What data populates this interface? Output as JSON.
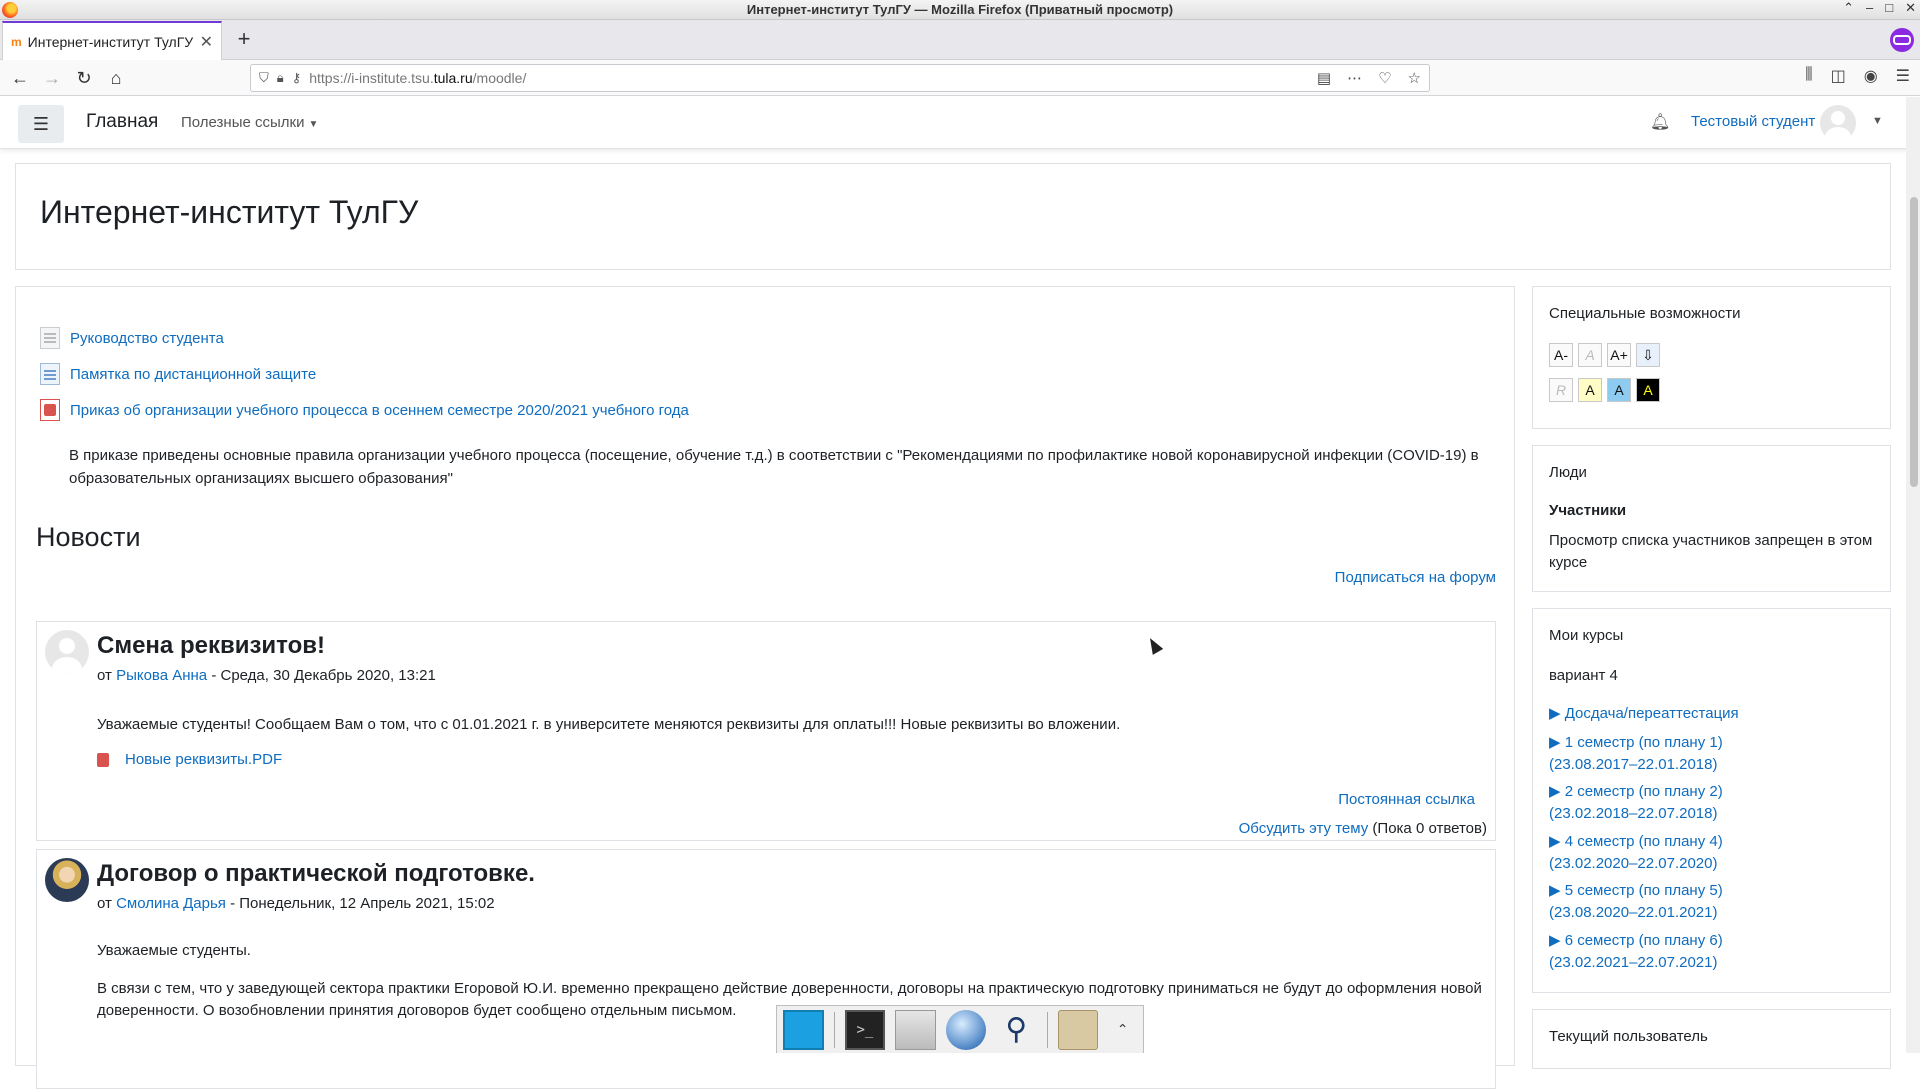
{
  "window": {
    "title": "Интернет-институт ТулГУ — Mozilla Firefox (Приватный просмотр)",
    "buttons": [
      "⌃",
      "–",
      "□",
      "✕"
    ]
  },
  "tabbar": {
    "tab_title": "Интернет-институт ТулГУ",
    "new_tab": "+"
  },
  "navbar": {
    "url_scheme": "https://i-institute.tsu.",
    "url_host": "tula.ru",
    "url_path": "/moodle/"
  },
  "moodle_header": {
    "brand": "Главная",
    "useful_links": "Полезные ссылки",
    "user_name": "Тестовый студент"
  },
  "page_header": {
    "title": "Интернет-институт ТулГУ"
  },
  "activities": [
    {
      "label": "Руководство студента",
      "icon": "page-icon"
    },
    {
      "label": "Памятка по дистанционной защите",
      "icon": "document-icon"
    },
    {
      "label": "Приказ об организации учебного процесса в осеннем семестре 2020/2021 учебного года",
      "icon": "pdf-icon"
    }
  ],
  "activity_description": "В приказе приведены основные правила организации учебного процесса (посещение, обучение т.д.) в соответствии с \"Рекомендациями по профилактике новой коронавирусной инфекции (COVID-19) в образовательных организациях высшего образования\"",
  "news": {
    "title": "Новости",
    "subscribe": "Подписаться на форум",
    "posts": [
      {
        "subject": "Смена реквизитов!",
        "by": "от",
        "author": "Рыкова Анна",
        "date": " - Среда, 30 Декабрь 2020, 13:21",
        "body": "Уважаемые студенты! Сообщаем Вам о том, что с 01.01.2021 г. в университете меняются реквизиты для оплаты!!! Новые реквизиты во вложении.",
        "attachment": "Новые реквизиты.PDF",
        "permalink": "Постоянная ссылка",
        "discuss": "Обсудить эту тему",
        "replies": "(Пока 0 ответов)"
      },
      {
        "subject": "Договор о практической подготовке.",
        "by": "от",
        "author": "Смолина Дарья",
        "date": " - Понедельник, 12 Апрель 2021, 15:02",
        "body1": "Уважаемые студенты.",
        "body2": "В связи с тем, что у заведующей сектора практики Егоровой Ю.И. временно прекращено действие доверенности, договоры на практическую подготовку приниматься не будут до оформления новой доверенности. О возобновлении принятия договоров будет сообщено отдельным письмом."
      }
    ]
  },
  "accessibility_block": {
    "title": "Специальные возможности",
    "buttons_row1": [
      "A-",
      "A",
      "A+"
    ],
    "buttons_row2": [
      "R",
      "A",
      "A",
      "A"
    ]
  },
  "people_block": {
    "title": "Люди",
    "participants": "Участники",
    "note": "Просмотр списка участников запрещен в этом курсе"
  },
  "my_courses_block": {
    "title": "Мои курсы",
    "variant": "вариант 4",
    "courses": [
      {
        "line1": "▶ Досдача/переаттестация",
        "line2": ""
      },
      {
        "line1": "▶ 1 семестр (по плану 1)",
        "line2": "(23.08.2017–22.01.2018)"
      },
      {
        "line1": "▶ 2 семестр (по плану 2)",
        "line2": "(23.02.2018–22.07.2018)"
      },
      {
        "line1": "▶ 4 семестр (по плану 4)",
        "line2": "(23.02.2020–22.07.2020)"
      },
      {
        "line1": "▶ 5 семестр (по плану 5)",
        "line2": "(23.08.2020–22.01.2021)"
      },
      {
        "line1": "▶ 6 семестр (по плану 6)",
        "line2": "(23.02.2021–22.07.2021)"
      }
    ]
  },
  "current_user_block": {
    "title": "Текущий пользователь"
  },
  "colors": {
    "link": "#0f6cbf",
    "text": "#1d2125",
    "private_accent": "#8a2be2"
  }
}
